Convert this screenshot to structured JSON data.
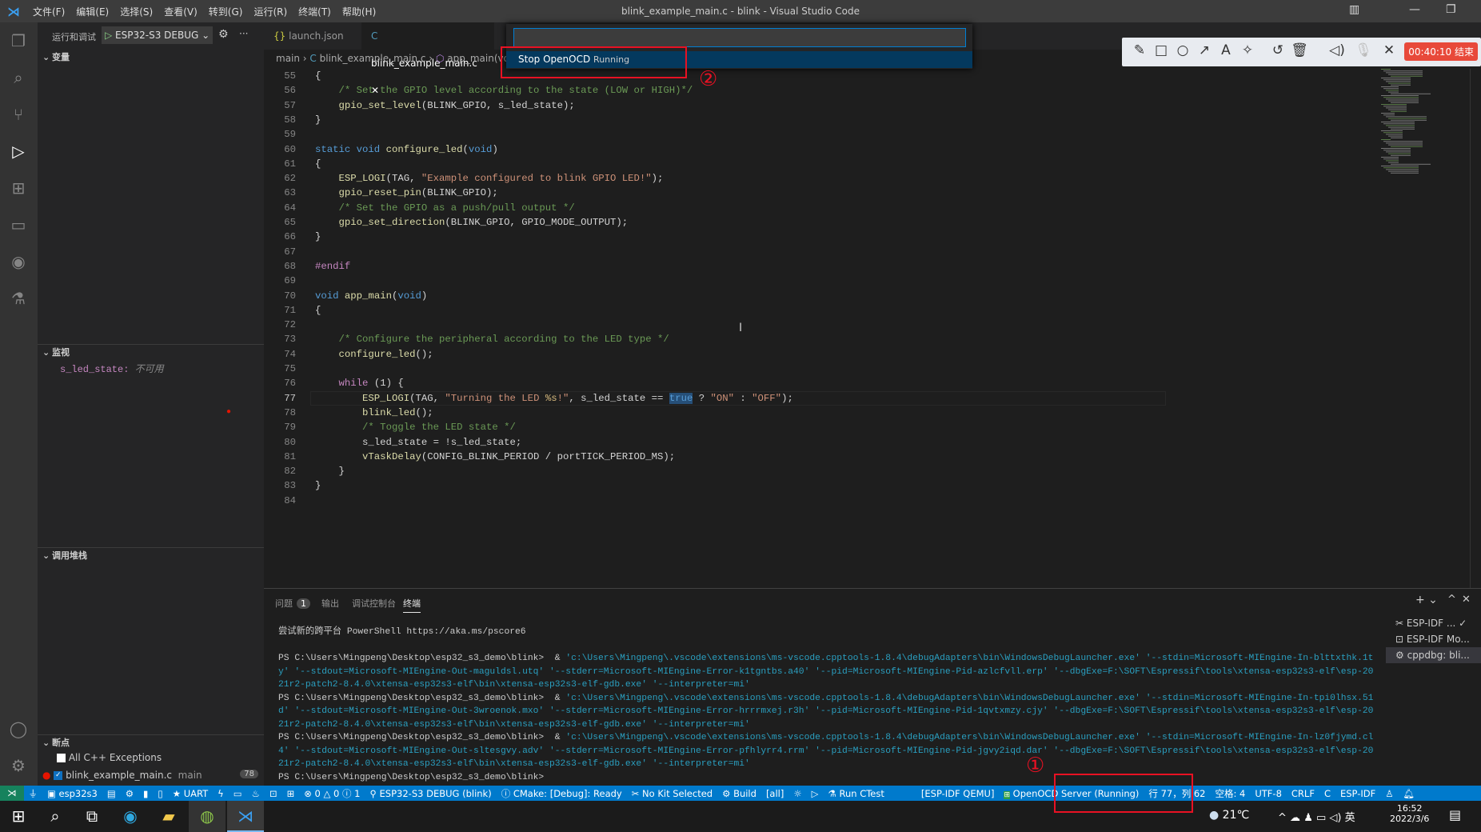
{
  "titlebar": {
    "title": "blink_example_main.c - blink - Visual Studio Code",
    "menus": [
      "文件(F)",
      "编辑(E)",
      "选择(S)",
      "查看(V)",
      "转到(G)",
      "运行(R)",
      "终端(T)",
      "帮助(H)"
    ]
  },
  "sidebar": {
    "header": "运行和调试",
    "config": "ESP32-S3 DEBUG",
    "sections": {
      "variables": "变量",
      "watch": "监视",
      "callstack": "调用堆栈",
      "breakpoints": "断点"
    },
    "watch": {
      "name": "s_led_state:",
      "value": "不可用"
    },
    "breakpoints": [
      {
        "label": "All C++ Exceptions",
        "checked": false
      },
      {
        "label": "blink_example_main.c",
        "detail": "main",
        "line": "78",
        "checked": true
      }
    ]
  },
  "tabs": [
    {
      "label": "launch.json",
      "icon": "{}"
    },
    {
      "label": "blink_example_main.c",
      "icon": "C",
      "active": true
    }
  ],
  "breadcrumb": {
    "folder": "main",
    "file": "blink_example_main.c",
    "symbol": "app_main(voi"
  },
  "quickpick": {
    "value": "",
    "item": "Stop OpenOCD",
    "item_detail": "Running"
  },
  "annotations": {
    "one": "①",
    "two": "②"
  },
  "annot_toolbar": {
    "timer": "00:40:10 结束"
  },
  "editor": {
    "current_line": 77,
    "breakpoint_line": 78,
    "lines": [
      {
        "n": 55,
        "t": [
          [
            "",
            "{"
          ]
        ]
      },
      {
        "n": 56,
        "t": [
          [
            "",
            "    "
          ],
          [
            "cm",
            "/* Set the GPIO level according to the state (LOW or HIGH)*/"
          ]
        ]
      },
      {
        "n": 57,
        "t": [
          [
            "",
            "    "
          ],
          [
            "fn",
            "gpio_set_level"
          ],
          [
            "",
            "(BLINK_GPIO, s_led_state);"
          ]
        ]
      },
      {
        "n": 58,
        "t": [
          [
            "",
            "}"
          ]
        ]
      },
      {
        "n": 59,
        "t": []
      },
      {
        "n": 60,
        "t": [
          [
            "kw",
            "static"
          ],
          [
            "",
            " "
          ],
          [
            "kw",
            "void"
          ],
          [
            "",
            " "
          ],
          [
            "fn",
            "configure_led"
          ],
          [
            "",
            "("
          ],
          [
            "kw",
            "void"
          ],
          [
            "",
            ")"
          ]
        ]
      },
      {
        "n": 61,
        "t": [
          [
            "",
            "{"
          ]
        ]
      },
      {
        "n": 62,
        "t": [
          [
            "",
            "    "
          ],
          [
            "fn",
            "ESP_LOGI"
          ],
          [
            "",
            "(TAG, "
          ],
          [
            "str",
            "\"Example configured to blink GPIO LED!\""
          ],
          [
            "",
            ");"
          ]
        ]
      },
      {
        "n": 63,
        "t": [
          [
            "",
            "    "
          ],
          [
            "fn",
            "gpio_reset_pin"
          ],
          [
            "",
            "(BLINK_GPIO);"
          ]
        ]
      },
      {
        "n": 64,
        "t": [
          [
            "",
            "    "
          ],
          [
            "cm",
            "/* Set the GPIO as a push/pull output */"
          ]
        ]
      },
      {
        "n": 65,
        "t": [
          [
            "",
            "    "
          ],
          [
            "fn",
            "gpio_set_direction"
          ],
          [
            "",
            "(BLINK_GPIO, GPIO_MODE_OUTPUT);"
          ]
        ]
      },
      {
        "n": 66,
        "t": [
          [
            "",
            "}"
          ]
        ]
      },
      {
        "n": 67,
        "t": []
      },
      {
        "n": 68,
        "t": [
          [
            "mac",
            "#endif"
          ]
        ]
      },
      {
        "n": 69,
        "t": []
      },
      {
        "n": 70,
        "t": [
          [
            "kw",
            "void"
          ],
          [
            "",
            " "
          ],
          [
            "fn",
            "app_main"
          ],
          [
            "",
            "("
          ],
          [
            "kw",
            "void"
          ],
          [
            "",
            ")"
          ]
        ]
      },
      {
        "n": 71,
        "t": [
          [
            "",
            "{"
          ]
        ]
      },
      {
        "n": 72,
        "t": []
      },
      {
        "n": 73,
        "t": [
          [
            "",
            "    "
          ],
          [
            "cm",
            "/* Configure the peripheral according to the LED type */"
          ]
        ]
      },
      {
        "n": 74,
        "t": [
          [
            "",
            "    "
          ],
          [
            "fn",
            "configure_led"
          ],
          [
            "",
            "();"
          ]
        ]
      },
      {
        "n": 75,
        "t": []
      },
      {
        "n": 76,
        "t": [
          [
            "",
            "    "
          ],
          [
            "mac",
            "while"
          ],
          [
            "",
            " (1) {"
          ]
        ]
      },
      {
        "n": 77,
        "t": [
          [
            "",
            "        "
          ],
          [
            "fn",
            "ESP_LOGI"
          ],
          [
            "",
            "(TAG, "
          ],
          [
            "str",
            "\"Turning the LED "
          ],
          [
            "esc",
            "%s"
          ],
          [
            "str",
            "!\""
          ],
          [
            "",
            ", s_led_state == "
          ],
          [
            "tr",
            "true"
          ],
          [
            "",
            " ? "
          ],
          [
            "str",
            "\"ON\""
          ],
          [
            "",
            " : "
          ],
          [
            "str",
            "\"OFF\""
          ],
          [
            "",
            ");"
          ]
        ]
      },
      {
        "n": 78,
        "t": [
          [
            "",
            "        "
          ],
          [
            "fn",
            "blink_led"
          ],
          [
            "",
            "();"
          ]
        ]
      },
      {
        "n": 79,
        "t": [
          [
            "",
            "        "
          ],
          [
            "cm",
            "/* Toggle the LED state */"
          ]
        ]
      },
      {
        "n": 80,
        "t": [
          [
            "",
            "        s_led_state = !s_led_state;"
          ]
        ]
      },
      {
        "n": 81,
        "t": [
          [
            "",
            "        "
          ],
          [
            "fn",
            "vTaskDelay"
          ],
          [
            "",
            "(CONFIG_BLINK_PERIOD / portTICK_PERIOD_MS);"
          ]
        ]
      },
      {
        "n": 82,
        "t": [
          [
            "",
            "    }"
          ]
        ]
      },
      {
        "n": 83,
        "t": [
          [
            "",
            "}"
          ]
        ]
      },
      {
        "n": 84,
        "t": []
      }
    ]
  },
  "panel": {
    "tabs": [
      {
        "label": "问题",
        "badge": "1"
      },
      {
        "label": "输出"
      },
      {
        "label": "调试控制台"
      },
      {
        "label": "终端",
        "active": true
      }
    ],
    "terminal": [
      [
        "尝试新的跨平台 PowerShell https://aka.ms/pscore6",
        ""
      ],
      [
        "",
        ""
      ],
      [
        "PS C:\\Users\\Mingpeng\\Desktop\\esp32_s3_demo\\blink>  & ",
        "'c:\\Users\\Mingpeng\\.vscode\\extensions\\ms-vscode.cpptools-1.8.4\\debugAdapters\\bin\\WindowsDebugLauncher.exe' '--stdin=Microsoft-MIEngine-In-blttxthk.1t"
      ],
      [
        "",
        "y' '--stdout=Microsoft-MIEngine-Out-maguldsl.utq' '--stderr=Microsoft-MIEngine-Error-k1tgntbs.a40' '--pid=Microsoft-MIEngine-Pid-azlcfvll.erp' '--dbgExe=F:\\SOFT\\Espressif\\tools\\xtensa-esp32s3-elf\\esp-20"
      ],
      [
        "",
        "21r2-patch2-8.4.0\\xtensa-esp32s3-elf\\bin\\xtensa-esp32s3-elf-gdb.exe' '--interpreter=mi'"
      ],
      [
        "PS C:\\Users\\Mingpeng\\Desktop\\esp32_s3_demo\\blink>  & ",
        "'c:\\Users\\Mingpeng\\.vscode\\extensions\\ms-vscode.cpptools-1.8.4\\debugAdapters\\bin\\WindowsDebugLauncher.exe' '--stdin=Microsoft-MIEngine-In-tpi0lhsx.51"
      ],
      [
        "",
        "d' '--stdout=Microsoft-MIEngine-Out-3wroenok.mxo' '--stderr=Microsoft-MIEngine-Error-hrrrmxej.r3h' '--pid=Microsoft-MIEngine-Pid-1qvtxmzy.cjy' '--dbgExe=F:\\SOFT\\Espressif\\tools\\xtensa-esp32s3-elf\\esp-20"
      ],
      [
        "",
        "21r2-patch2-8.4.0\\xtensa-esp32s3-elf\\bin\\xtensa-esp32s3-elf-gdb.exe' '--interpreter=mi'"
      ],
      [
        "PS C:\\Users\\Mingpeng\\Desktop\\esp32_s3_demo\\blink>  & ",
        "'c:\\Users\\Mingpeng\\.vscode\\extensions\\ms-vscode.cpptools-1.8.4\\debugAdapters\\bin\\WindowsDebugLauncher.exe' '--stdin=Microsoft-MIEngine-In-lz0fjymd.cl"
      ],
      [
        "",
        "4' '--stdout=Microsoft-MIEngine-Out-sltesgvy.adv' '--stderr=Microsoft-MIEngine-Error-pfhlyrr4.rrm' '--pid=Microsoft-MIEngine-Pid-jgvy2iqd.dar' '--dbgExe=F:\\SOFT\\Espressif\\tools\\xtensa-esp32s3-elf\\esp-20"
      ],
      [
        "",
        "21r2-patch2-8.4.0\\xtensa-esp32s3-elf\\bin\\xtensa-esp32s3-elf-gdb.exe' '--interpreter=mi'"
      ],
      [
        "PS C:\\Users\\Mingpeng\\Desktop\\esp32_s3_demo\\blink>",
        ""
      ]
    ],
    "terminals": [
      "ESP-IDF ...",
      "ESP-IDF Mo...",
      "cppdbg: bli..."
    ]
  },
  "status": {
    "items": [
      "esp32s3",
      "UART",
      "⊗ 0 △ 0 ⓘ 1",
      "ESP32-S3 DEBUG (blink)",
      "CMake: [Debug]: Ready",
      "No Kit Selected",
      "Build",
      "[all]",
      "Run CTest",
      "[ESP-IDF QEMU]",
      "OpenOCD Server (Running)",
      "行 77，列 62",
      "空格: 4",
      "UTF-8",
      "CRLF",
      "C",
      "ESP-IDF"
    ]
  },
  "taskbar": {
    "weather": "21℃",
    "ime": "英",
    "time": "16:52",
    "date": "2022/3/6"
  },
  "colors": {
    "statusbar": "#007acc",
    "accent": "#007fd4",
    "annotation_red": "#e81123"
  }
}
